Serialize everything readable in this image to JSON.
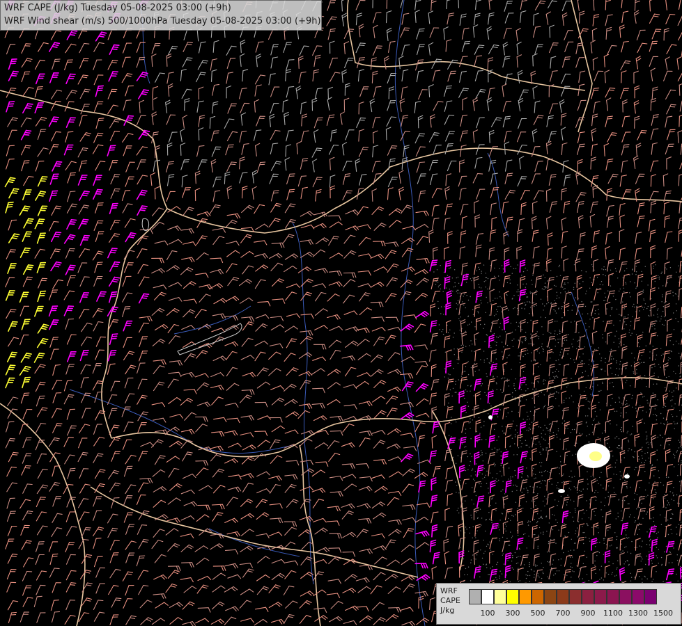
{
  "map": {
    "title_line1": "WRF CAPE (J/kg) Tuesday 05-08-2025 03:00 (+9h)",
    "title_line2": "WRF Wind shear (m/s) 500/1000hPa Tuesday 05-08-2025 03:00 (+9h)",
    "legend": {
      "label_lines": [
        "WRF",
        "CAPE",
        "J/kg"
      ],
      "ticks": [
        "100",
        "300",
        "500",
        "700",
        "900",
        "1100",
        "1300",
        "1500"
      ],
      "colors": [
        "#b0b0b0",
        "#ffffff",
        "#ffff99",
        "#ffff00",
        "#ff9900",
        "#cc6600",
        "#8b4513",
        "#8b3a1a",
        "#8b2e2e",
        "#8b2040",
        "#8b1a4a",
        "#8b1550",
        "#8b1060",
        "#8b0a6a",
        "#7a0070"
      ]
    },
    "colors": {
      "background": "#000000",
      "border": "#e8c6a0",
      "river": "#3a5ab8",
      "barb_low": "#a9a9a9",
      "barb_mid": "#c98b82",
      "barb_high": "#e89080",
      "barb_magenta": "#ff00ff",
      "barb_yellow": "#ffff33"
    }
  }
}
